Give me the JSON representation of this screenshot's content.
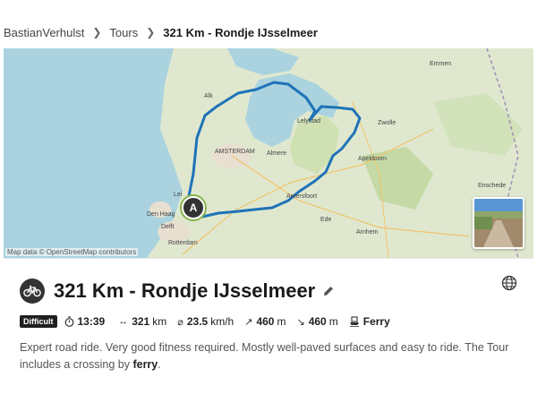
{
  "breadcrumb": {
    "user": "BastianVerhulst",
    "section": "Tours",
    "current": "321 Km - Rondje IJsselmeer"
  },
  "map": {
    "attribution": "Map data © OpenStreetMap contributors",
    "start_marker": "A",
    "labels": {
      "den_haag": "Den Haag",
      "delft": "Delft",
      "rotterdam": "Rotterdam",
      "amsterdam": "AMSTERDAM",
      "almere": "Almere",
      "lelystad": "Lelystad",
      "zwolle": "Zwolle",
      "emmen": "Emmen",
      "apeldoorn": "Apeldoorn",
      "enschede": "Enschede",
      "arnhem": "Arnhem",
      "ede": "Ede",
      "amersfoort": "Amersfoort",
      "alkmaar": "Alk",
      "leiden": "Lei"
    }
  },
  "tour": {
    "title": "321 Km - Rondje IJsselmeer",
    "difficulty": "Difficult",
    "duration": "13:39",
    "distance_value": "321",
    "distance_unit": "km",
    "speed_value": "23.5",
    "speed_unit": "km/h",
    "ascent_value": "460",
    "ascent_unit": "m",
    "descent_value": "460",
    "descent_unit": "m",
    "transport": "Ferry",
    "description_main": "Expert road ride. Very good fitness required. Mostly well-paved surfaces and easy to ride. The Tour includes a crossing by ",
    "description_bold": "ferry",
    "description_end": "."
  },
  "colors": {
    "route": "#1f73b7",
    "water": "#aad3df",
    "land": "#dfe8cf",
    "badge": "#1f1f1f"
  }
}
